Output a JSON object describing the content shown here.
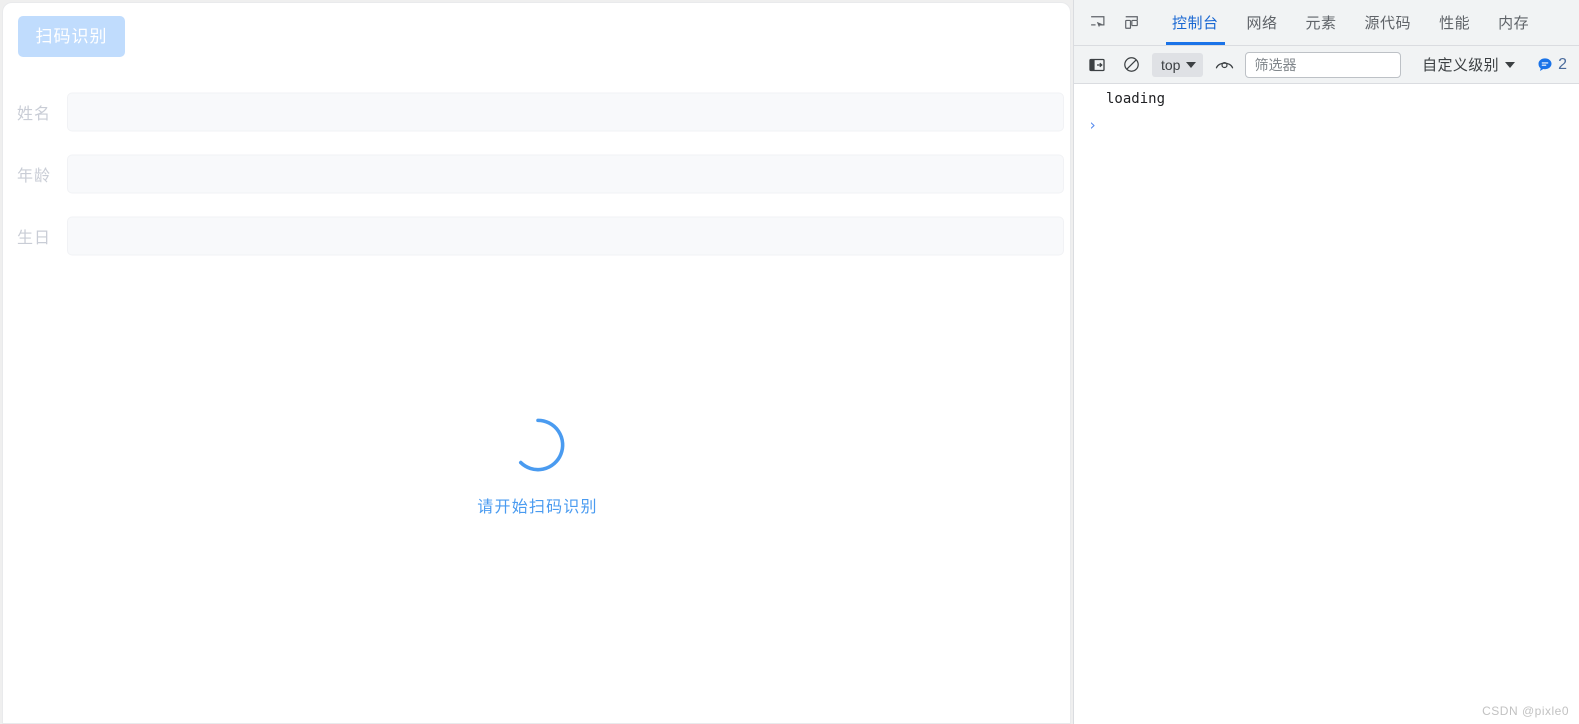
{
  "app": {
    "scan_button_label": "扫码识别",
    "form": [
      {
        "label": "姓名",
        "value": "",
        "placeholder": ""
      },
      {
        "label": "年龄",
        "value": "",
        "placeholder": ""
      },
      {
        "label": "生日",
        "value": "",
        "placeholder": ""
      }
    ],
    "loading": {
      "spinner_icon": "loading-spinner-icon",
      "text": "请开始扫码识别",
      "color": "#4a9bf0"
    }
  },
  "devtools": {
    "inspect_icon": "inspect-element-icon",
    "device_icon": "device-toolbar-icon",
    "tabs": [
      {
        "label": "控制台",
        "active": true
      },
      {
        "label": "网络",
        "active": false
      },
      {
        "label": "元素",
        "active": false
      },
      {
        "label": "源代码",
        "active": false
      },
      {
        "label": "性能",
        "active": false
      },
      {
        "label": "内存",
        "active": false
      }
    ],
    "toolbar": {
      "sidebar_icon": "console-sidebar-icon",
      "clear_icon": "clear-console-icon",
      "context_value": "top",
      "eye_icon": "live-expression-icon",
      "filter_placeholder": "筛选器",
      "filter_value": "",
      "levels_label": "自定义级别",
      "message_icon": "message-bubble-icon",
      "message_count": "2"
    },
    "console": {
      "messages": [
        {
          "text": "loading"
        }
      ],
      "prompt_symbol": "›",
      "input_value": ""
    },
    "accent_color": "#1a73e8"
  },
  "watermark": "CSDN @pixle0"
}
